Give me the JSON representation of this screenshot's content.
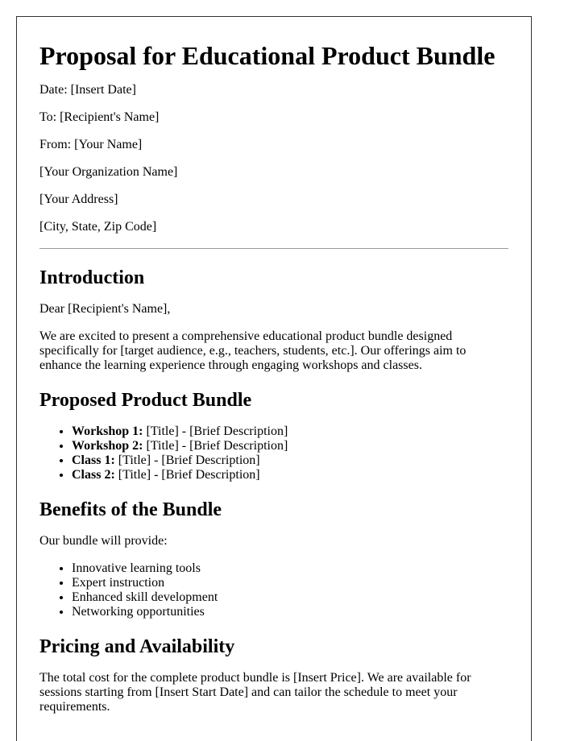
{
  "document": {
    "title": "Proposal for Educational Product Bundle",
    "header_fields": [
      "Date: [Insert Date]",
      "To: [Recipient's Name]",
      "From: [Your Name]",
      "[Your Organization Name]",
      "[Your Address]",
      "[City, State, Zip Code]"
    ],
    "introduction": {
      "heading": "Introduction",
      "salutation": "Dear [Recipient's Name],",
      "body": "We are excited to present a comprehensive educational product bundle designed specifically for [target audience, e.g., teachers, students, etc.]. Our offerings aim to enhance the learning experience through engaging workshops and classes."
    },
    "bundle": {
      "heading": "Proposed Product Bundle",
      "items": [
        {
          "label": "Workshop 1:",
          "text": " [Title] - [Brief Description]"
        },
        {
          "label": "Workshop 2:",
          "text": " [Title] - [Brief Description]"
        },
        {
          "label": "Class 1:",
          "text": " [Title] - [Brief Description]"
        },
        {
          "label": "Class 2:",
          "text": " [Title] - [Brief Description]"
        }
      ]
    },
    "benefits": {
      "heading": "Benefits of the Bundle",
      "lead": "Our bundle will provide:",
      "items": [
        "Innovative learning tools",
        "Expert instruction",
        "Enhanced skill development",
        "Networking opportunities"
      ]
    },
    "pricing": {
      "heading": "Pricing and Availability",
      "body": "The total cost for the complete product bundle is [Insert Price]. We are available for sessions starting from [Insert Start Date] and can tailor the schedule to meet your requirements."
    }
  }
}
